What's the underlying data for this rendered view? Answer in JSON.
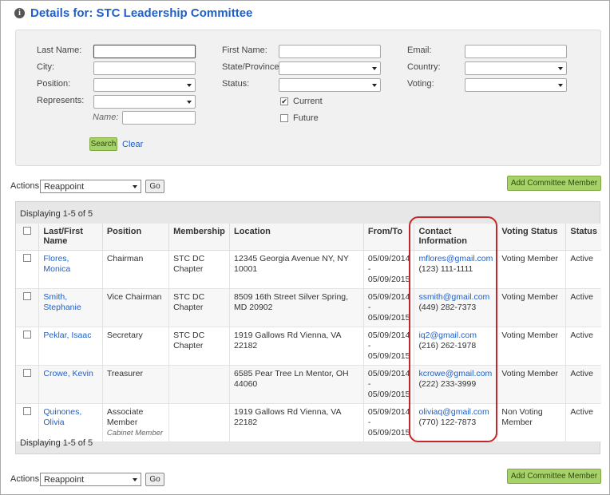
{
  "page": {
    "title": "Details for: STC Leadership Committee",
    "accent": "#1f5fc7",
    "highlight_color": "#c0282d"
  },
  "filters": {
    "last_name_label": "Last Name:",
    "first_name_label": "First Name:",
    "email_label": "Email:",
    "city_label": "City:",
    "state_label": "State/Province:",
    "country_label": "Country:",
    "position_label": "Position:",
    "status_label": "Status:",
    "voting_label": "Voting:",
    "represents_label": "Represents:",
    "name_label": "Name:",
    "current_label": "Current",
    "current_checked": "✔",
    "future_label": "Future",
    "search_label": "Search",
    "clear_label": "Clear"
  },
  "actions": {
    "label": "Actions:",
    "selected": "Reappoint",
    "go_label": "Go",
    "add_label": "Add Committee Member"
  },
  "grid": {
    "displaying": "Displaying 1-5 of 5",
    "columns": [
      "Last/First Name",
      "Position",
      "Membership",
      "Location",
      "From/To",
      "Contact Information",
      "Voting Status",
      "Status"
    ],
    "rows": [
      {
        "name": "Flores, Monica",
        "position": "Chairman",
        "position_sub": "",
        "membership": "STC DC Chapter",
        "location": "12345 Georgia Avenue NY, NY 10001",
        "from": "05/09/2014",
        "sep": "-",
        "to": "05/09/2015",
        "email": "mflores@gmail.com",
        "phone": "(123) 111-1111",
        "voting": "Voting Member",
        "status": "Active"
      },
      {
        "name": "Smith, Stephanie",
        "position": "Vice Chairman",
        "position_sub": "",
        "membership": "STC DC Chapter",
        "location": "8509 16th Street Silver Spring, MD 20902",
        "from": "05/09/2014",
        "sep": "-",
        "to": "05/09/2015",
        "email": "ssmith@gmail.com",
        "phone": "(449) 282-7373",
        "voting": "Voting Member",
        "status": "Active"
      },
      {
        "name": "Peklar, Isaac",
        "position": "Secretary",
        "position_sub": "",
        "membership": "STC DC Chapter",
        "location": "1919 Gallows Rd Vienna, VA 22182",
        "from": "05/09/2014",
        "sep": "-",
        "to": "05/09/2015",
        "email": "iq2@gmail.com",
        "phone": "(216) 262-1978",
        "voting": "Voting Member",
        "status": "Active"
      },
      {
        "name": "Crowe, Kevin",
        "position": "Treasurer",
        "position_sub": "",
        "membership": "",
        "location": "6585 Pear Tree Ln Mentor, OH 44060",
        "from": "05/09/2014",
        "sep": "-",
        "to": "05/09/2015",
        "email": "kcrowe@gmail.com",
        "phone": "(222) 233-3999",
        "voting": "Voting Member",
        "status": "Active"
      },
      {
        "name": "Quinones, Olivia",
        "position": "Associate Member",
        "position_sub": "Cabinet Member",
        "membership": "",
        "location": "1919 Gallows Rd Vienna, VA 22182",
        "from": "05/09/2014",
        "sep": "-",
        "to": "05/09/2015",
        "email": "oliviaq@gmail.com",
        "phone": "(770) 122-7873",
        "voting": "Non Voting Member",
        "status": "Active"
      }
    ]
  }
}
